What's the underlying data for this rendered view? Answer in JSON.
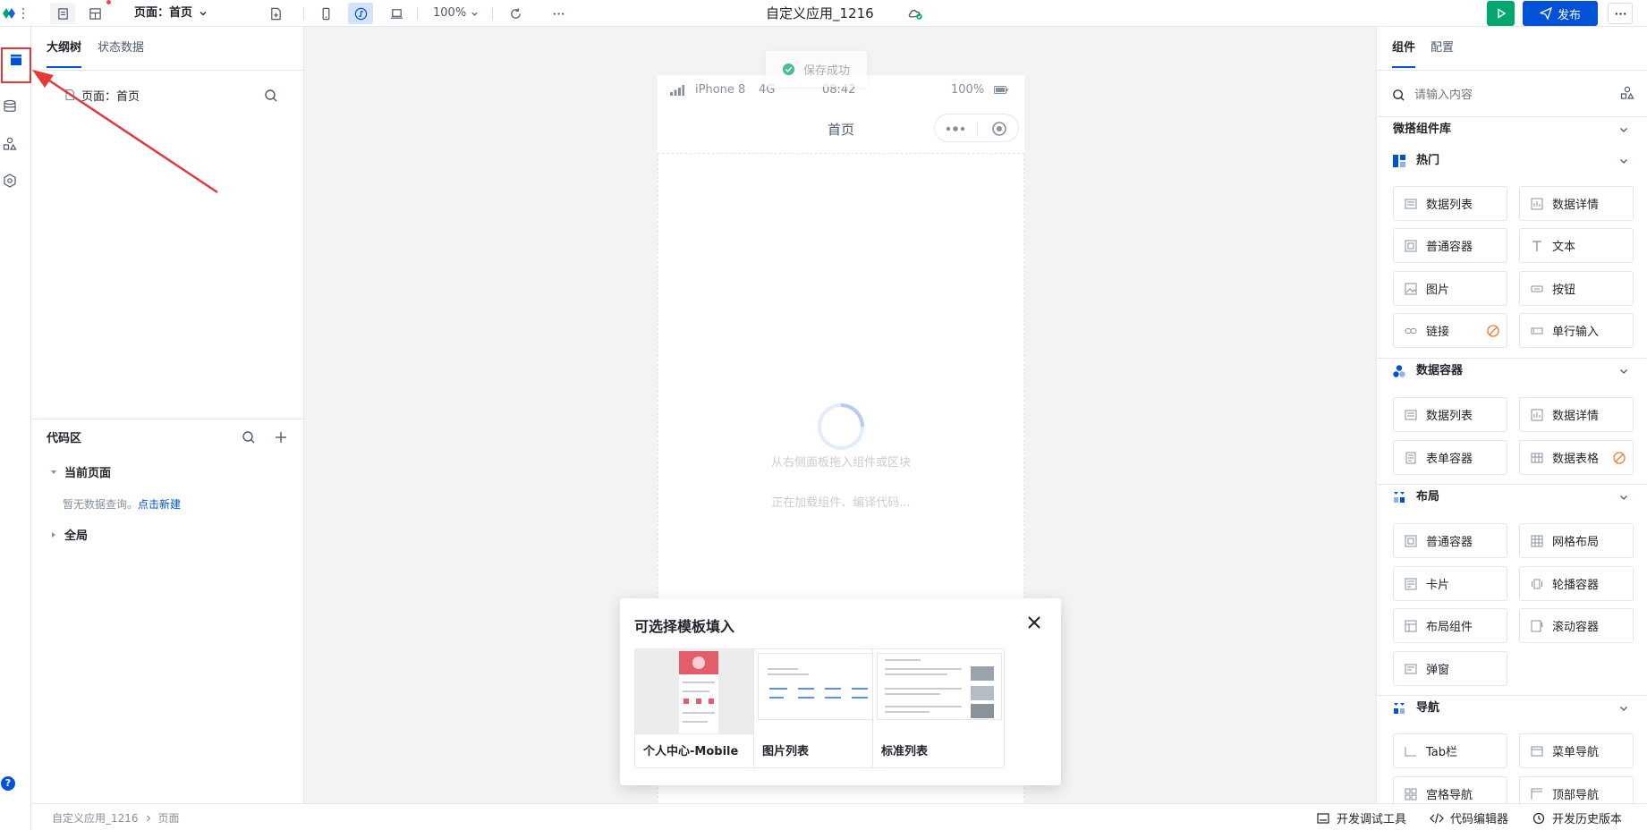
{
  "topbar": {
    "page_selector": "页面：首页",
    "zoom": "100%",
    "app_title": "自定义应用_1216",
    "publish_label": "发布"
  },
  "left_panel": {
    "tabs": [
      {
        "label": "大纲树"
      },
      {
        "label": "状态数据"
      }
    ],
    "tree_item": "页面：首页",
    "code_area": {
      "title": "代码区",
      "current_page": "当前页面",
      "empty_text": "暂无数据查询。",
      "create_link": "点击新建",
      "global": "全局"
    }
  },
  "canvas": {
    "toast": "保存成功",
    "phone": {
      "carrier": "iPhone 8",
      "network": "4G",
      "time": "08:42",
      "battery": "100%",
      "title": "首页"
    },
    "drag_hint": "从右侧面板拖入组件或区块",
    "loading_hint": "正在加载组件、编译代码..."
  },
  "template_modal": {
    "title": "可选择模板填入",
    "templates": [
      {
        "label": "个人中心-Mobile"
      },
      {
        "label": "图片列表"
      },
      {
        "label": "标准列表"
      }
    ]
  },
  "right_panel": {
    "tabs": [
      {
        "label": "组件"
      },
      {
        "label": "配置"
      }
    ],
    "search_placeholder": "请输入内容",
    "library": "微搭组件库",
    "sections": [
      {
        "title": "热门",
        "items": [
          "数据列表",
          "数据详情",
          "普通容器",
          "文本",
          "图片",
          "按钮",
          "链接",
          "单行输入"
        ]
      },
      {
        "title": "数据容器",
        "items": [
          "数据列表",
          "数据详情",
          "表单容器",
          "数据表格"
        ]
      },
      {
        "title": "布局",
        "items": [
          "普通容器",
          "网格布局",
          "卡片",
          "轮播容器",
          "布局组件",
          "滚动容器",
          "弹窗"
        ]
      },
      {
        "title": "导航",
        "items": [
          "Tab栏",
          "菜单导航",
          "宫格导航",
          "顶部导航"
        ]
      }
    ]
  },
  "statusbar": {
    "breadcrumb": [
      "自定义应用_1216",
      "页面"
    ],
    "dev_tools": "开发调试工具",
    "code_editor": "代码编辑器",
    "history": "开发历史版本"
  },
  "colors": {
    "primary": "#0052d9",
    "success": "#00a870",
    "annotation": "#e53935"
  }
}
